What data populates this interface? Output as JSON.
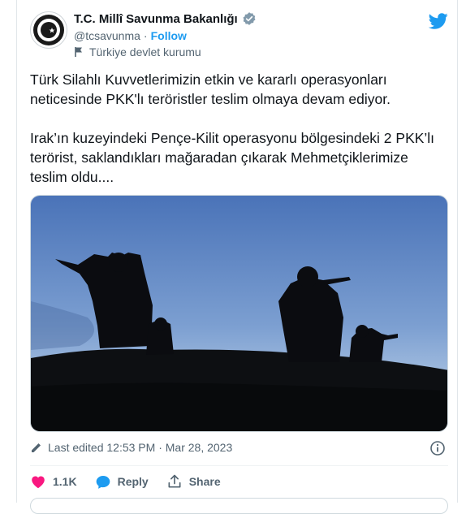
{
  "colors": {
    "accent": "#1d9bf0",
    "like": "#f91880",
    "verified": "#829aab",
    "text": "#0f1419",
    "muted": "#536471"
  },
  "author": {
    "name": "T.C. Millî Savunma Bakanlığı",
    "handle": "@tcsavunma",
    "separator": "·",
    "follow_label": "Follow",
    "label": "Türkiye devlet kurumu",
    "icons": {
      "verified": "verified-badge-icon",
      "flag": "flag-icon",
      "logo": "twitter-bird-icon"
    }
  },
  "tweet": {
    "text": "Türk Silahlı Kuvvetlerimizin etkin ve kararlı operasyonları neticesinde PKK'lı teröristler teslim olmaya devam ediyor.\n\nIrak’ın kuzeyindeki Pençe-Kilit operasyonu bölgesindeki 2 PKK’lı terörist, saklandıkları mağaradan çıkarak Mehmetçiklerimize teslim oldu...."
  },
  "meta": {
    "edited_label": "Last edited 12:53 PM · Mar 28, 2023"
  },
  "actions": {
    "like_count": "1.1K",
    "reply_label": "Reply",
    "share_label": "Share"
  }
}
